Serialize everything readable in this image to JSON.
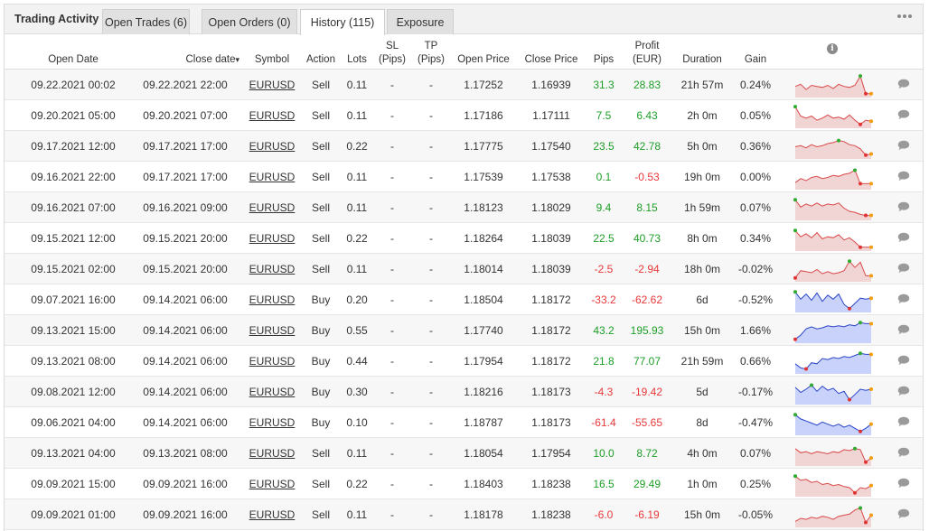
{
  "app": {
    "title": "Trading Activity",
    "tabs": [
      {
        "label": "Open Trades (6)",
        "active": false
      },
      {
        "label": "Open Orders (0)",
        "active": false
      },
      {
        "label": "History (115)",
        "active": true
      },
      {
        "label": "Exposure",
        "active": false
      }
    ],
    "menu_icon": "more-dots-icon"
  },
  "table": {
    "columns": {
      "open_date": "Open Date",
      "close_date": "Close date",
      "sort_indicator": "▾",
      "symbol": "Symbol",
      "action": "Action",
      "lots": "Lots",
      "sl": "SL",
      "sl_unit": "(Pips)",
      "tp": "TP",
      "tp_unit": "(Pips)",
      "open_price": "Open Price",
      "close_price": "Close Price",
      "pips": "Pips",
      "profit": "Profit",
      "profit_unit": "(EUR)",
      "duration": "Duration",
      "gain": "Gain",
      "chart_icon": "info-icon",
      "info_glyph": "i"
    },
    "rows": [
      {
        "open": "09.22.2021 00:02",
        "close": "09.22.2021 22:00",
        "symbol": "EURUSD",
        "action": "Sell",
        "lots": "0.11",
        "sl": "-",
        "tp": "-",
        "open_price": "1.17252",
        "close_price": "1.16939",
        "pips": "31.3",
        "profit": "28.83",
        "duration": "21h 57m",
        "gain": "0.24%",
        "pips_sign": "pos",
        "profit_sign": "pos",
        "spark": {
          "type": "sell",
          "values": [
            0.45,
            0.55,
            0.3,
            0.5,
            0.45,
            0.4,
            0.5,
            0.35,
            0.55,
            0.45,
            0.4,
            0.5,
            0.95,
            0.1,
            0.1
          ],
          "max_index": 12,
          "min_index": 13
        }
      },
      {
        "open": "09.20.2021 05:00",
        "close": "09.20.2021 07:00",
        "symbol": "EURUSD",
        "action": "Sell",
        "lots": "0.11",
        "sl": "-",
        "tp": "-",
        "open_price": "1.17186",
        "close_price": "1.17111",
        "pips": "7.5",
        "profit": "6.43",
        "duration": "2h 0m",
        "gain": "0.05%",
        "pips_sign": "pos",
        "profit_sign": "pos",
        "spark": {
          "type": "sell",
          "values": [
            0.95,
            0.5,
            0.4,
            0.5,
            0.3,
            0.4,
            0.55,
            0.4,
            0.45,
            0.35,
            0.55,
            0.3,
            0.1,
            0.3,
            0.25
          ],
          "max_index": 0,
          "min_index": 12
        }
      },
      {
        "open": "09.17.2021 12:00",
        "close": "09.17.2021 17:00",
        "symbol": "EURUSD",
        "action": "Sell",
        "lots": "0.22",
        "sl": "-",
        "tp": "-",
        "open_price": "1.17775",
        "close_price": "1.17540",
        "pips": "23.5",
        "profit": "42.78",
        "duration": "5h 0m",
        "gain": "0.36%",
        "pips_sign": "pos",
        "profit_sign": "pos",
        "spark": {
          "type": "sell",
          "values": [
            0.5,
            0.55,
            0.45,
            0.6,
            0.5,
            0.55,
            0.65,
            0.7,
            0.8,
            0.75,
            0.6,
            0.55,
            0.4,
            0.1,
            0.15
          ],
          "max_index": 8,
          "min_index": 13
        }
      },
      {
        "open": "09.16.2021 22:00",
        "close": "09.17.2021 17:00",
        "symbol": "EURUSD",
        "action": "Sell",
        "lots": "0.11",
        "sl": "-",
        "tp": "-",
        "open_price": "1.17539",
        "close_price": "1.17538",
        "pips": "0.1",
        "profit": "-0.53",
        "duration": "19h 0m",
        "gain": "0.00%",
        "pips_sign": "pos",
        "profit_sign": "neg",
        "spark": {
          "type": "sell",
          "values": [
            0.25,
            0.45,
            0.35,
            0.5,
            0.55,
            0.45,
            0.5,
            0.6,
            0.55,
            0.65,
            0.7,
            0.85,
            0.2,
            0.2,
            0.2
          ],
          "max_index": 11,
          "min_index": 12
        }
      },
      {
        "open": "09.16.2021 07:00",
        "close": "09.16.2021 09:00",
        "symbol": "EURUSD",
        "action": "Sell",
        "lots": "0.11",
        "sl": "-",
        "tp": "-",
        "open_price": "1.18123",
        "close_price": "1.18029",
        "pips": "9.4",
        "profit": "8.15",
        "duration": "1h 59m",
        "gain": "0.07%",
        "pips_sign": "pos",
        "profit_sign": "pos",
        "spark": {
          "type": "sell",
          "values": [
            0.9,
            0.55,
            0.7,
            0.6,
            0.75,
            0.6,
            0.7,
            0.65,
            0.75,
            0.5,
            0.35,
            0.3,
            0.2,
            0.15,
            0.15
          ],
          "max_index": 0,
          "min_index": 13
        }
      },
      {
        "open": "09.15.2021 12:00",
        "close": "09.15.2021 20:00",
        "symbol": "EURUSD",
        "action": "Sell",
        "lots": "0.22",
        "sl": "-",
        "tp": "-",
        "open_price": "1.18264",
        "close_price": "1.18039",
        "pips": "22.5",
        "profit": "40.73",
        "duration": "8h 0m",
        "gain": "0.34%",
        "pips_sign": "pos",
        "profit_sign": "pos",
        "spark": {
          "type": "sell",
          "values": [
            0.9,
            0.6,
            0.75,
            0.55,
            0.8,
            0.5,
            0.6,
            0.55,
            0.7,
            0.45,
            0.55,
            0.35,
            0.1,
            0.1,
            0.1
          ],
          "max_index": 0,
          "min_index": 12
        }
      },
      {
        "open": "09.15.2021 02:00",
        "close": "09.15.2021 20:00",
        "symbol": "EURUSD",
        "action": "Sell",
        "lots": "0.11",
        "sl": "-",
        "tp": "-",
        "open_price": "1.18014",
        "close_price": "1.18039",
        "pips": "-2.5",
        "profit": "-2.94",
        "duration": "18h 0m",
        "gain": "-0.02%",
        "pips_sign": "neg",
        "profit_sign": "neg",
        "spark": {
          "type": "sell",
          "values": [
            0.1,
            0.45,
            0.4,
            0.35,
            0.5,
            0.3,
            0.4,
            0.3,
            0.35,
            0.45,
            0.9,
            0.6,
            0.85,
            0.2,
            0.2
          ],
          "max_index": 10,
          "min_index": 0
        }
      },
      {
        "open": "09.07.2021 16:00",
        "close": "09.14.2021 06:00",
        "symbol": "EURUSD",
        "action": "Buy",
        "lots": "0.20",
        "sl": "-",
        "tp": "-",
        "open_price": "1.18504",
        "close_price": "1.18172",
        "pips": "-33.2",
        "profit": "-62.62",
        "duration": "6d",
        "gain": "-0.52%",
        "pips_sign": "neg",
        "profit_sign": "neg",
        "spark": {
          "type": "buy",
          "values": [
            0.9,
            0.55,
            0.8,
            0.5,
            0.85,
            0.45,
            0.75,
            0.55,
            0.8,
            0.3,
            0.1,
            0.35,
            0.6,
            0.55,
            0.6
          ],
          "max_index": 0,
          "min_index": 10
        }
      },
      {
        "open": "09.13.2021 15:00",
        "close": "09.14.2021 06:00",
        "symbol": "EURUSD",
        "action": "Buy",
        "lots": "0.55",
        "sl": "-",
        "tp": "-",
        "open_price": "1.17740",
        "close_price": "1.18172",
        "pips": "43.2",
        "profit": "195.93",
        "duration": "15h 0m",
        "gain": "1.66%",
        "pips_sign": "pos",
        "profit_sign": "pos",
        "spark": {
          "type": "buy",
          "values": [
            0.1,
            0.3,
            0.6,
            0.7,
            0.6,
            0.65,
            0.75,
            0.7,
            0.75,
            0.7,
            0.8,
            0.75,
            0.9,
            0.85,
            0.85
          ],
          "max_index": 12,
          "min_index": 0
        }
      },
      {
        "open": "09.13.2021 08:00",
        "close": "09.14.2021 06:00",
        "symbol": "EURUSD",
        "action": "Buy",
        "lots": "0.44",
        "sl": "-",
        "tp": "-",
        "open_price": "1.17954",
        "close_price": "1.18172",
        "pips": "21.8",
        "profit": "77.07",
        "duration": "21h 59m",
        "gain": "0.66%",
        "pips_sign": "pos",
        "profit_sign": "pos",
        "spark": {
          "type": "buy",
          "values": [
            0.4,
            0.2,
            0.15,
            0.45,
            0.4,
            0.65,
            0.6,
            0.7,
            0.65,
            0.75,
            0.7,
            0.8,
            0.9,
            0.85,
            0.85
          ],
          "max_index": 12,
          "min_index": 2
        }
      },
      {
        "open": "09.08.2021 12:00",
        "close": "09.14.2021 06:00",
        "symbol": "EURUSD",
        "action": "Buy",
        "lots": "0.30",
        "sl": "-",
        "tp": "-",
        "open_price": "1.18216",
        "close_price": "1.18173",
        "pips": "-4.3",
        "profit": "-19.42",
        "duration": "5d",
        "gain": "-0.17%",
        "pips_sign": "neg",
        "profit_sign": "neg",
        "spark": {
          "type": "buy",
          "values": [
            0.75,
            0.5,
            0.65,
            0.85,
            0.55,
            0.8,
            0.6,
            0.7,
            0.45,
            0.55,
            0.15,
            0.4,
            0.65,
            0.6,
            0.65
          ],
          "max_index": 3,
          "min_index": 10
        }
      },
      {
        "open": "09.06.2021 04:00",
        "close": "09.14.2021 06:00",
        "symbol": "EURUSD",
        "action": "Buy",
        "lots": "0.10",
        "sl": "-",
        "tp": "-",
        "open_price": "1.18787",
        "close_price": "1.18173",
        "pips": "-61.4",
        "profit": "-55.65",
        "duration": "8d",
        "gain": "-0.47%",
        "pips_sign": "neg",
        "profit_sign": "neg",
        "spark": {
          "type": "buy",
          "values": [
            0.9,
            0.7,
            0.6,
            0.5,
            0.4,
            0.55,
            0.45,
            0.35,
            0.45,
            0.3,
            0.4,
            0.25,
            0.1,
            0.25,
            0.45
          ],
          "max_index": 0,
          "min_index": 12
        }
      },
      {
        "open": "09.13.2021 04:00",
        "close": "09.13.2021 08:00",
        "symbol": "EURUSD",
        "action": "Sell",
        "lots": "0.11",
        "sl": "-",
        "tp": "-",
        "open_price": "1.18054",
        "close_price": "1.17954",
        "pips": "10.0",
        "profit": "8.72",
        "duration": "4h 0m",
        "gain": "0.07%",
        "pips_sign": "pos",
        "profit_sign": "pos",
        "spark": {
          "type": "sell",
          "values": [
            0.75,
            0.55,
            0.6,
            0.5,
            0.6,
            0.55,
            0.5,
            0.6,
            0.55,
            0.7,
            0.65,
            0.75,
            0.7,
            0.1,
            0.3
          ],
          "max_index": 11,
          "min_index": 13
        }
      },
      {
        "open": "09.09.2021 15:00",
        "close": "09.09.2021 16:00",
        "symbol": "EURUSD",
        "action": "Sell",
        "lots": "0.22",
        "sl": "-",
        "tp": "-",
        "open_price": "1.18403",
        "close_price": "1.18238",
        "pips": "16.5",
        "profit": "29.49",
        "duration": "1h 0m",
        "gain": "0.25%",
        "pips_sign": "pos",
        "profit_sign": "pos",
        "spark": {
          "type": "sell",
          "values": [
            0.9,
            0.7,
            0.75,
            0.6,
            0.65,
            0.5,
            0.55,
            0.45,
            0.5,
            0.4,
            0.35,
            0.1,
            0.35,
            0.3,
            0.45
          ],
          "max_index": 0,
          "min_index": 11
        }
      },
      {
        "open": "09.09.2021 01:00",
        "close": "09.09.2021 16:00",
        "symbol": "EURUSD",
        "action": "Sell",
        "lots": "0.11",
        "sl": "-",
        "tp": "-",
        "open_price": "1.18178",
        "close_price": "1.18238",
        "pips": "-6.0",
        "profit": "-6.19",
        "duration": "15h 0m",
        "gain": "-0.05%",
        "pips_sign": "neg",
        "profit_sign": "neg",
        "spark": {
          "type": "sell",
          "values": [
            0.2,
            0.35,
            0.3,
            0.4,
            0.35,
            0.45,
            0.4,
            0.3,
            0.45,
            0.5,
            0.55,
            0.75,
            0.85,
            0.15,
            0.5
          ],
          "max_index": 12,
          "min_index": 13
        }
      }
    ]
  },
  "colors": {
    "profit_positive": "#1e9e28",
    "profit_negative": "#e8383a",
    "sell_line": "#d94a4a",
    "sell_fill": "#f1d4d4",
    "buy_line": "#2a45c8",
    "buy_fill": "#c8d2fa",
    "max_marker": "#2faa2f",
    "min_marker": "#e23333",
    "end_marker": "#f39c12"
  }
}
